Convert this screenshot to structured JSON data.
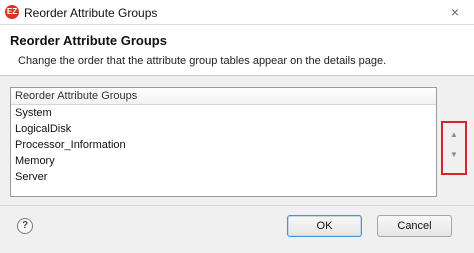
{
  "window": {
    "title": "Reorder Attribute Groups",
    "app_icon": "app-logo-icon",
    "close_glyph": "×"
  },
  "header": {
    "title": "Reorder Attribute Groups",
    "description": "Change the order that the attribute group tables appear on the details page."
  },
  "table": {
    "column_header": "Reorder Attribute Groups",
    "rows": [
      "System",
      "LogicalDisk",
      "Processor_Information",
      "Memory",
      "Server"
    ]
  },
  "reorder_controls": {
    "up_glyph": "▲",
    "down_glyph": "▼",
    "highlight_color": "#d6262a"
  },
  "footer": {
    "help_glyph": "?",
    "ok_label": "OK",
    "cancel_label": "Cancel"
  }
}
